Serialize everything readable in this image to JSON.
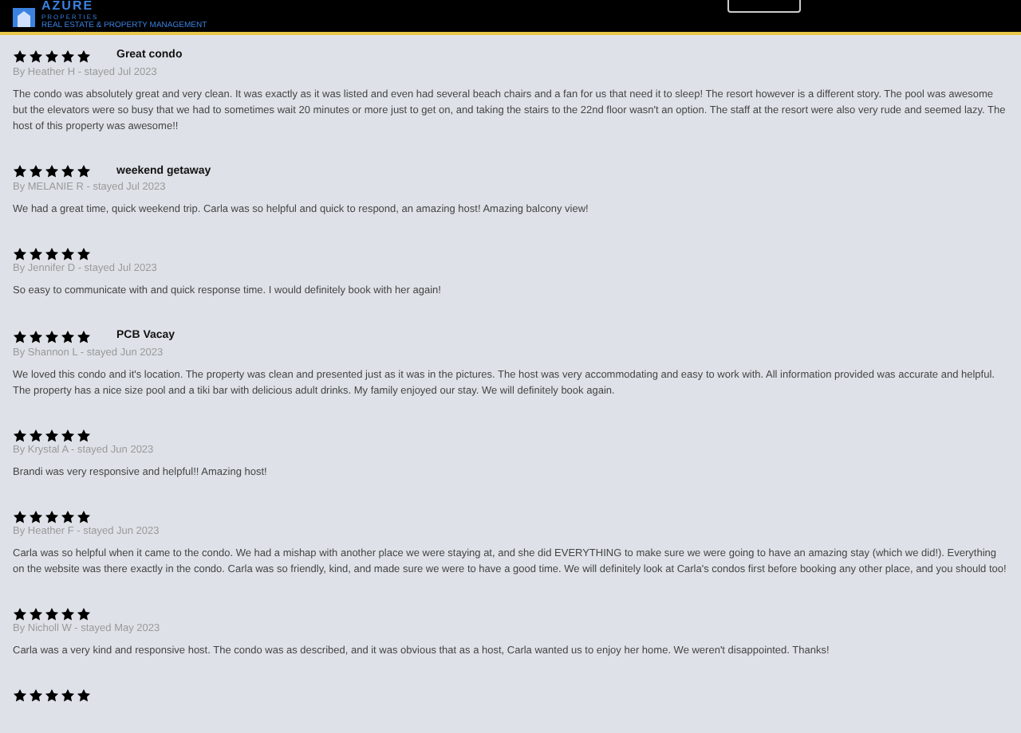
{
  "header": {
    "logo_name": "AZURE",
    "logo_sub": "PROPERTIES",
    "tagline": "REAL ESTATE & PROPERTY MANAGEMENT"
  },
  "reviews": [
    {
      "stars": 5,
      "title": "Great condo",
      "byline": "By Heather H - stayed Jul 2023",
      "text": "The condo was absolutely great and very clean. It was exactly as it was listed and even had several beach chairs and a fan for us that need it to sleep! The resort however is a different story. The pool was awesome but the elevators were so busy that we had to sometimes wait 20 minutes or more just to get on, and taking the stairs to the 22nd floor wasn't an option. The staff at the resort were also very rude and seemed lazy. The host of this property was awesome!!"
    },
    {
      "stars": 5,
      "title": "weekend getaway",
      "byline": "By MELANIE R - stayed Jul 2023",
      "text": "We had a great time, quick weekend trip. Carla was so helpful and quick to respond, an amazing host! Amazing balcony view!"
    },
    {
      "stars": 5,
      "byline": "By Jennifer D - stayed Jul 2023",
      "text": "So easy to communicate with and quick response time. I would definitely book with her again!"
    },
    {
      "stars": 5,
      "title": "PCB Vacay",
      "byline": "By Shannon L - stayed Jun 2023",
      "text": "We loved this condo and it's location. The property was clean and presented just as it was in the pictures. The host was very accommodating and easy to work with. All information provided was accurate and helpful. The property has a nice size pool and a tiki bar with delicious adult drinks. My family enjoyed our stay. We will definitely book again."
    },
    {
      "stars": 5,
      "byline": "By Krystal A - stayed Jun 2023",
      "text": "Brandi was very responsive and helpful!! Amazing host!"
    },
    {
      "stars": 5,
      "byline": "By Heather F - stayed Jun 2023",
      "text": "Carla was so helpful when it came to the condo. We had a mishap with another place we were staying at, and she did EVERYTHING to make sure we were going to have an amazing stay (which we did!). Everything on the website was there exactly in the condo. Carla was so friendly, kind, and made sure we were to have a good time. We will definitely look at Carla's condos first before booking any other place, and you should too!"
    },
    {
      "stars": 5,
      "byline": "By Nicholl W - stayed May 2023",
      "text": "Carla was a very kind and responsive host. The condo was as described, and it was obvious that as a host, Carla wanted us to enjoy her home. We weren't disappointed. Thanks!"
    },
    {
      "stars": 5
    }
  ]
}
